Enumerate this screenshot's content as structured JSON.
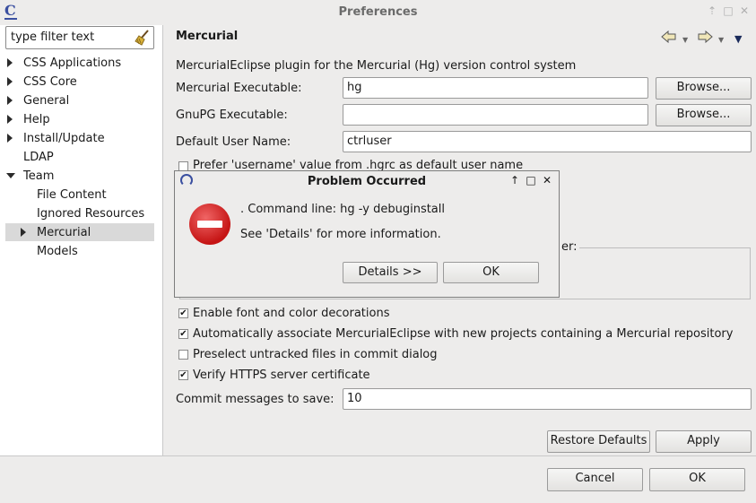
{
  "window": {
    "title": "Preferences",
    "app_icon": "eclipse-c-icon",
    "controls": [
      "arrow-up-icon",
      "maximize-icon",
      "close-icon"
    ]
  },
  "filter": {
    "placeholder": "type filter text",
    "clear_icon": "broom-icon"
  },
  "tree": {
    "items": [
      {
        "label": "CSS Applications",
        "expander": "closed"
      },
      {
        "label": "CSS Core",
        "expander": "closed"
      },
      {
        "label": "General",
        "expander": "closed"
      },
      {
        "label": "Help",
        "expander": "closed"
      },
      {
        "label": "Install/Update",
        "expander": "closed"
      },
      {
        "label": "LDAP",
        "expander": "none"
      },
      {
        "label": "Team",
        "expander": "open"
      },
      {
        "label": "File Content",
        "expander": "none"
      },
      {
        "label": "Ignored Resources",
        "expander": "none"
      },
      {
        "label": "Mercurial",
        "expander": "closed",
        "selected": true
      },
      {
        "label": "Models",
        "expander": "none"
      }
    ]
  },
  "page": {
    "title": "Mercurial",
    "nav_icons": [
      "back-arrow-icon",
      "chevron-down-icon",
      "forward-arrow-icon",
      "chevron-down-icon",
      "view-menu-icon"
    ],
    "description": "MercurialEclipse plugin for the Mercurial (Hg) version control system",
    "hg_label": "Mercurial Executable:",
    "hg_value": "hg",
    "gpg_label": "GnuPG Executable:",
    "gpg_value": "",
    "browse_label": "Browse...",
    "user_label": "Default User Name:",
    "user_value": "ctrluser",
    "prefer_username_label": "Prefer 'username' value from .hgrc as default user name",
    "group_fragment": "er:",
    "checkboxes": [
      {
        "label": "Enable font and color decorations",
        "checked": true
      },
      {
        "label": "Automatically associate MercurialEclipse with new projects containing a Mercurial repository",
        "checked": true
      },
      {
        "label": "Preselect untracked files in commit dialog",
        "checked": false
      },
      {
        "label": "Verify HTTPS server certificate",
        "checked": true
      }
    ],
    "commit_label": "Commit messages to save:",
    "commit_value": "10",
    "restore_defaults": "Restore Defaults",
    "apply": "Apply"
  },
  "footer": {
    "cancel": "Cancel",
    "ok": "OK"
  },
  "dialog": {
    "title": "Problem Occurred",
    "message": ". Command line: hg -y debuginstall",
    "details_hint": "See 'Details' for more information.",
    "details_button": "Details >>",
    "ok_button": "OK",
    "icon": "error-icon"
  }
}
